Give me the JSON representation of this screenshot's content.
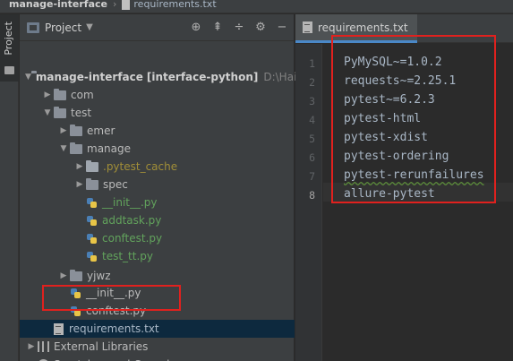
{
  "breadcrumb": {
    "project": "manage-interface",
    "file": "requirements.txt"
  },
  "tool_window": {
    "tab_label": "Project"
  },
  "panel": {
    "title": "Project",
    "tools": [
      "target-icon",
      "collapse-all-icon",
      "expand-icon",
      "gear-icon",
      "minimize-icon"
    ]
  },
  "tree": [
    {
      "label": "manage-interface",
      "suffix": "[interface-python]",
      "path": "D:\\Hai",
      "arrow": "down",
      "icon": "folder"
    },
    {
      "label": "com",
      "arrow": "right",
      "icon": "folder"
    },
    {
      "label": "test",
      "arrow": "down",
      "icon": "folder"
    },
    {
      "label": "emer",
      "arrow": "right",
      "icon": "folder"
    },
    {
      "label": "manage",
      "arrow": "down",
      "icon": "folder"
    },
    {
      "label": ".pytest_cache",
      "arrow": "right",
      "icon": "folder"
    },
    {
      "label": "spec",
      "arrow": "right",
      "icon": "folder"
    },
    {
      "label": "__init__.py",
      "icon": "python"
    },
    {
      "label": "addtask.py",
      "icon": "python"
    },
    {
      "label": "conftest.py",
      "icon": "python"
    },
    {
      "label": "test_tt.py",
      "icon": "python"
    },
    {
      "label": "yjwz",
      "arrow": "right",
      "icon": "folder"
    },
    {
      "label": "__init__.py",
      "icon": "python"
    },
    {
      "label": "conftest.py",
      "icon": "python"
    },
    {
      "label": "requirements.txt",
      "icon": "text",
      "selected": true
    },
    {
      "label": "External Libraries",
      "arrow": "right",
      "icon": "library"
    },
    {
      "label": "Scratches and Consoles",
      "icon": "scratch"
    }
  ],
  "editor": {
    "tab_label": "requirements.txt",
    "line_numbers": [
      "1",
      "2",
      "3",
      "4",
      "5",
      "6",
      "7",
      "8"
    ],
    "lines": [
      "PyMySQL~=1.0.2",
      "requests~=2.25.1",
      "pytest~=6.2.3",
      "pytest-html",
      "pytest-xdist",
      "pytest-ordering",
      "pytest-rerunfailures",
      "allure-pytest"
    ]
  }
}
